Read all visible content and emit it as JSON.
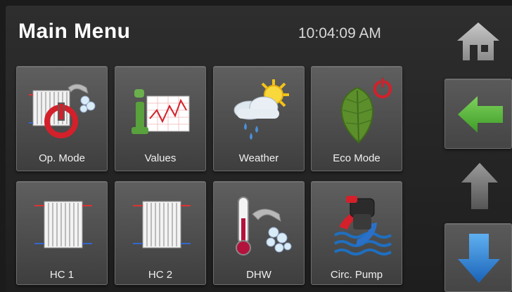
{
  "header": {
    "title": "Main Menu",
    "time": "10:04:09 AM"
  },
  "tiles": [
    {
      "label": "Op. Mode",
      "icon": "radiator-power-icon"
    },
    {
      "label": "Values",
      "icon": "values-chart-icon"
    },
    {
      "label": "Weather",
      "icon": "weather-icon"
    },
    {
      "label": "Eco Mode",
      "icon": "eco-leaf-icon"
    },
    {
      "label": "HC 1",
      "icon": "radiator-icon"
    },
    {
      "label": "HC 2",
      "icon": "radiator-icon"
    },
    {
      "label": "DHW",
      "icon": "hot-water-icon"
    },
    {
      "label": "Circ. Pump",
      "icon": "circulation-pump-icon"
    }
  ],
  "navigation": {
    "home": "home-icon",
    "back": "back-arrow-icon",
    "up": "up-arrow-icon",
    "down": "down-arrow-icon"
  },
  "colors": {
    "back_arrow": "#45b02e",
    "down_arrow": "#2a86d8",
    "power_red": "#d4202a"
  }
}
